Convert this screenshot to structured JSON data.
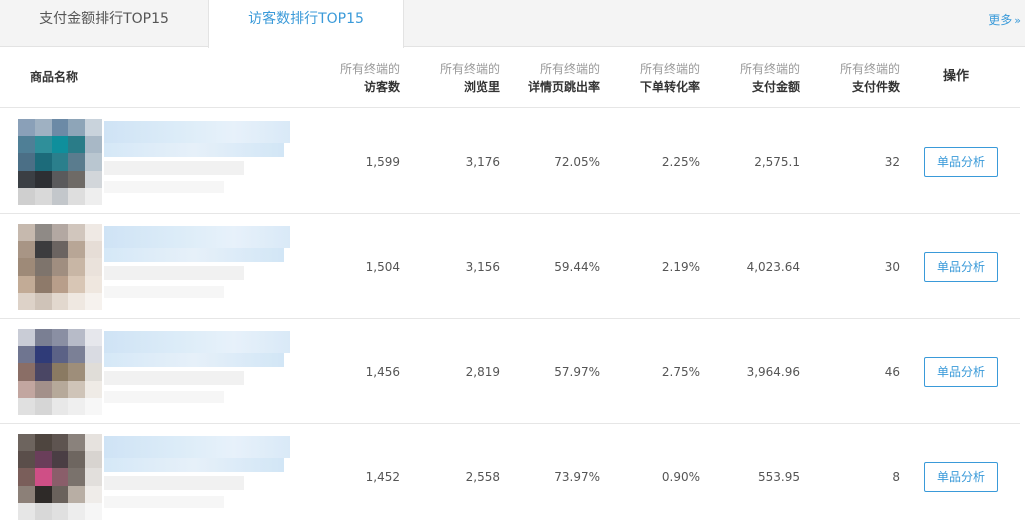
{
  "tabs": [
    {
      "label": "支付金额排行TOP15",
      "active": false
    },
    {
      "label": "访客数排行TOP15",
      "active": true
    }
  ],
  "more": {
    "label": "更多",
    "chevron": "»"
  },
  "table": {
    "headers": {
      "name": "商品名称",
      "visitors": {
        "sub": "所有终端的",
        "main": "访客数"
      },
      "pageviews": {
        "sub": "所有终端的",
        "main": "浏览里"
      },
      "bounce": {
        "sub": "所有终端的",
        "main": "详情页跳出率"
      },
      "conversion": {
        "sub": "所有终端的",
        "main": "下单转化率"
      },
      "pay_amount": {
        "sub": "所有终端的",
        "main": "支付金额"
      },
      "pay_items": {
        "sub": "所有终端的",
        "main": "支付件数"
      },
      "op": "操作"
    },
    "rows": [
      {
        "visitors": "1,599",
        "pageviews": "3,176",
        "bounce": "72.05%",
        "conversion": "2.25%",
        "pay_amount": "2,575.1",
        "pay_items": "32",
        "action": "单品分析"
      },
      {
        "visitors": "1,504",
        "pageviews": "3,156",
        "bounce": "59.44%",
        "conversion": "2.19%",
        "pay_amount": "4,023.64",
        "pay_items": "30",
        "action": "单品分析"
      },
      {
        "visitors": "1,456",
        "pageviews": "2,819",
        "bounce": "57.97%",
        "conversion": "2.75%",
        "pay_amount": "3,964.96",
        "pay_items": "46",
        "action": "单品分析"
      },
      {
        "visitors": "1,452",
        "pageviews": "2,558",
        "bounce": "73.97%",
        "conversion": "0.90%",
        "pay_amount": "553.95",
        "pay_items": "8",
        "action": "单品分析"
      }
    ]
  },
  "colors": {
    "accent": "#3a9ad9",
    "border": "#e6e6e6",
    "tab_bg": "#f4f4f4"
  },
  "thumbnail_palettes": [
    [
      "#8aa0b8",
      "#9fb1c2",
      "#6c8aa6",
      "#8ea5b8",
      "#c9d3dc",
      "#4f7f96",
      "#2f8f9a",
      "#0f8f9c",
      "#2a7c88",
      "#a8b8c6",
      "#4b6f86",
      "#1c6b7a",
      "#2b7f8c",
      "#5a7c8e",
      "#b9c6d0",
      "#3b3f44",
      "#2d2f33",
      "#5a5a5c",
      "#6e6a66",
      "#d2d6da",
      "#cfcfcf",
      "#d9d9d9",
      "#c3c7cb",
      "#dedede",
      "#eeeeee"
    ],
    [
      "#c6b9ae",
      "#8f8a86",
      "#b3a8a2",
      "#d1c6bd",
      "#efe9e4",
      "#a89585",
      "#3c3c3e",
      "#6b6461",
      "#b8a696",
      "#e6ddd6",
      "#9e8a78",
      "#7e746c",
      "#a08e80",
      "#c8b6a5",
      "#eae2db",
      "#c2ab96",
      "#8e7a6a",
      "#b89e8a",
      "#d8c6b5",
      "#efe7df",
      "#ddd2c8",
      "#cfc3b8",
      "#e2d8ce",
      "#efe8e1",
      "#f6f2ee"
    ],
    [
      "#c9ccd6",
      "#7a7f93",
      "#8a8fa3",
      "#b7bbc8",
      "#e6e7ec",
      "#6f7590",
      "#2f3b78",
      "#5b6286",
      "#7b8096",
      "#d9dbe2",
      "#8a6e66",
      "#4a4664",
      "#8a7a62",
      "#9e8e7a",
      "#e0ddd8",
      "#c2a6a0",
      "#a3908a",
      "#b6a99a",
      "#cfc4b8",
      "#efebe6",
      "#e0e0e0",
      "#d6d6d6",
      "#e8e8e8",
      "#efefef",
      "#f7f7f7"
    ],
    [
      "#6d645e",
      "#4e453f",
      "#5e5450",
      "#8a827c",
      "#e6e2de",
      "#5a4e4a",
      "#6a3e5a",
      "#4a3e44",
      "#6e6660",
      "#d8d4d0",
      "#7a5e5a",
      "#cf4f86",
      "#8a5e6a",
      "#7a726c",
      "#e2dfdc",
      "#8c8078",
      "#2e2a28",
      "#6a625c",
      "#b8aea4",
      "#efece9",
      "#e6e6e6",
      "#d8d8d8",
      "#e0e0e0",
      "#ededed",
      "#f6f6f6"
    ]
  ]
}
